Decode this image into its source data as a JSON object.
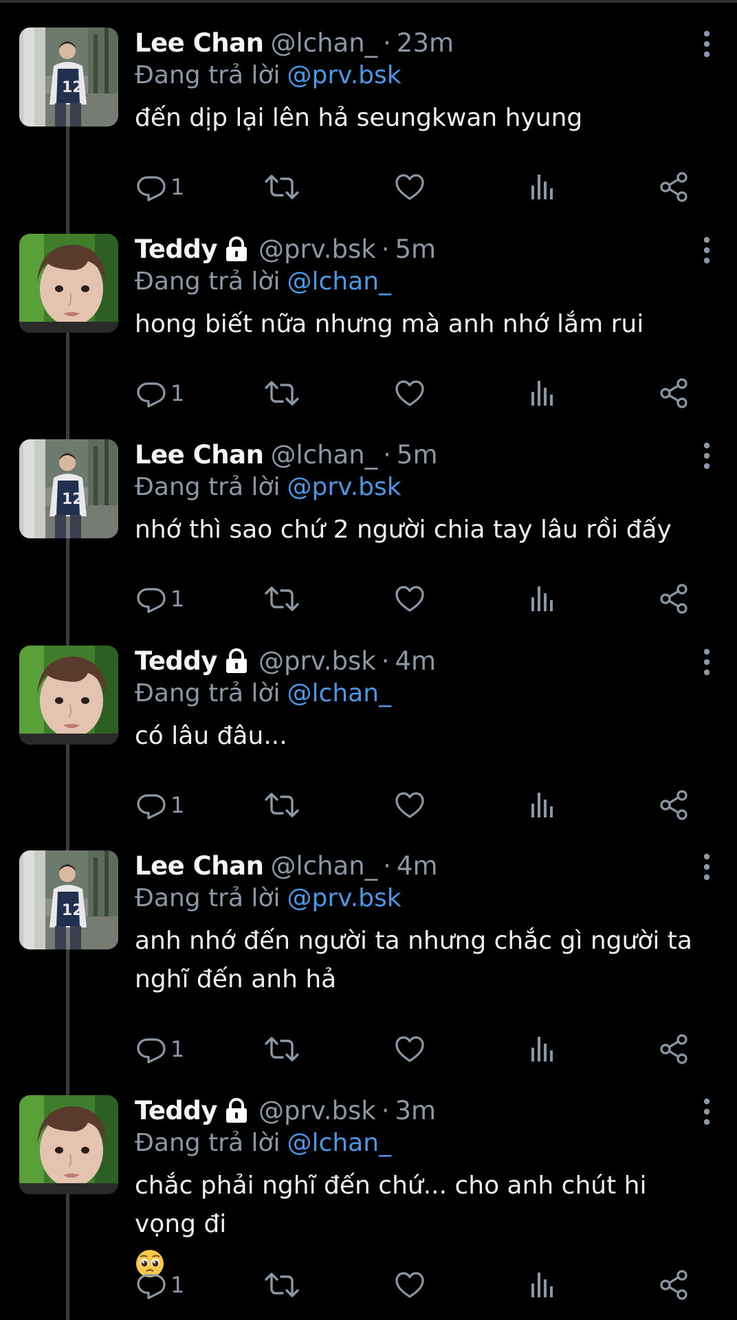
{
  "colors": {
    "background": "#000000",
    "text": "#e7e9ea",
    "secondary_text": "#8b98a5",
    "link": "#4a99e9",
    "thread_line": "#3a3d40"
  },
  "icons": {
    "reply": "reply-icon",
    "retweet": "retweet-icon",
    "like": "heart-icon",
    "views": "bar-chart-icon",
    "share": "share-icon",
    "more": "more-vertical-icon",
    "lock": "lock-icon"
  },
  "reply_prefix": "Đang trả lời",
  "tweets": [
    {
      "name": "Lee Chan",
      "locked": false,
      "handle": "@lchan_",
      "separator": "·",
      "time": "23m",
      "reply_to": "@prv.bsk",
      "text": "đến dịp lại lên hả seungkwan hyung",
      "emoji": "",
      "reply_count": "1"
    },
    {
      "name": "Teddy",
      "locked": true,
      "handle": "@prv.bsk",
      "separator": "·",
      "time": "5m",
      "reply_to": "@lchan_",
      "text": "hong biết nữa nhưng mà anh nhớ lắm rui",
      "emoji": "",
      "reply_count": "1"
    },
    {
      "name": "Lee Chan",
      "locked": false,
      "handle": "@lchan_",
      "separator": "·",
      "time": "5m",
      "reply_to": "@prv.bsk",
      "text": "nhớ thì sao chứ 2 người chia tay lâu rồi đấy",
      "emoji": "",
      "reply_count": "1"
    },
    {
      "name": "Teddy",
      "locked": true,
      "handle": "@prv.bsk",
      "separator": "·",
      "time": "4m",
      "reply_to": "@lchan_",
      "text": "có lâu đâu...",
      "emoji": "",
      "reply_count": "1"
    },
    {
      "name": "Lee Chan",
      "locked": false,
      "handle": "@lchan_",
      "separator": "·",
      "time": "4m",
      "reply_to": "@prv.bsk",
      "text": "anh nhớ đến người ta nhưng chắc gì người ta nghĩ đến anh hả",
      "emoji": "",
      "reply_count": "1"
    },
    {
      "name": "Teddy",
      "locked": true,
      "handle": "@prv.bsk",
      "separator": "·",
      "time": "3m",
      "reply_to": "@lchan_",
      "text": "chắc phải nghĩ đến chứ... cho anh chút hi vọng đi",
      "emoji": "pleading-face-emoji",
      "reply_count": "1"
    }
  ]
}
